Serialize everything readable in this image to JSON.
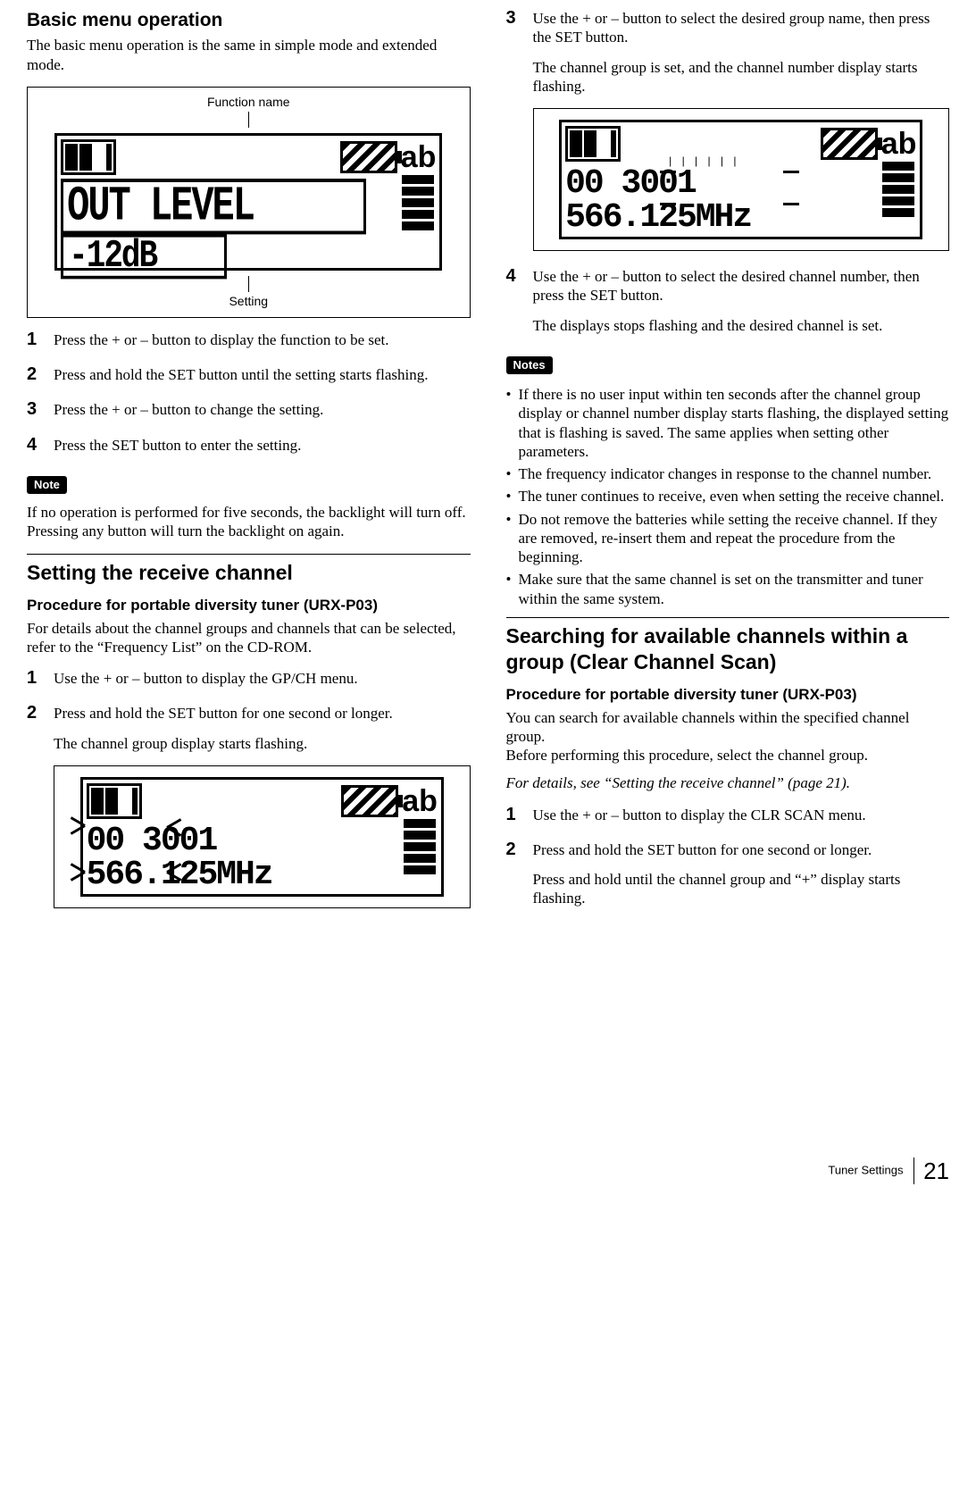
{
  "left": {
    "h_basic": "Basic menu operation",
    "basic_intro": "The basic menu operation is the same in simple mode and extended mode.",
    "fig1": {
      "label_top": "Function name",
      "lcd_ab": "ab",
      "lcd_line1": "OUT LEVEL",
      "lcd_line2": "-12dB",
      "label_bottom": "Setting"
    },
    "steps1": [
      "Press the + or – button to display the function to be set.",
      "Press and hold the SET button until the setting starts flashing.",
      "Press the + or – button to change the setting.",
      "Press the SET button to enter the setting."
    ],
    "note_badge": "Note",
    "note_text": "If no operation is performed for five seconds, the backlight will turn off. Pressing any button will turn the backlight on again.",
    "h_receive": "Setting the receive channel",
    "sub_proc": "Procedure for portable diversity tuner (URX-P03)",
    "proc_intro": "For details about the channel groups and channels that can be selected, refer to the “Frequency List” on the CD-ROM.",
    "steps2": {
      "s1": "Use the + or – button to display the GP/CH menu.",
      "s2": "Press and hold the SET button for one second or longer.",
      "s2_result": "The channel group display starts flashing."
    },
    "fig2": {
      "lcd_ab": "ab",
      "lcd_line1": "00  3001",
      "lcd_line2": "566.125MHz"
    }
  },
  "right": {
    "steps3": {
      "s3": "Use the + or – button to select the desired group name, then press the SET button.",
      "s3_result": "The channel group is set, and the channel number display starts flashing.",
      "s4": "Use the + or – button to select the desired channel number, then press the SET button.",
      "s4_result": "The displays stops flashing and the desired channel is set."
    },
    "fig3": {
      "lcd_ab": "ab",
      "lcd_line1": "00  3001",
      "lcd_line2": "566.125MHz"
    },
    "notes_badge": "Notes",
    "notes": [
      "If there is no user input within ten seconds after the channel group display or channel number display starts flashing, the displayed setting that is flashing is saved. The same applies when setting other parameters.",
      "The frequency indicator changes in response to the channel number.",
      "The tuner continues to receive, even when setting the receive channel.",
      "Do not remove the batteries while setting the receive channel. If they are removed, re-insert them and repeat the procedure from the beginning.",
      "Make sure that the same channel is set on the transmitter and tuner within the same system."
    ],
    "h_search": "Searching for available channels within a group (Clear Channel Scan)",
    "sub_proc2": "Procedure for portable diversity tuner (URX-P03)",
    "search_intro1": "You can search for available channels within the specified channel group.",
    "search_intro2": "Before performing this procedure, select the channel group.",
    "xref": "For details, see “Setting the receive channel” (page 21).",
    "steps4": {
      "s1": "Use the + or – button to display the CLR SCAN menu.",
      "s2": "Press and hold the SET button for one second or longer.",
      "s2_result": "Press and hold until the channel group and “+” display starts flashing."
    }
  },
  "footer": {
    "section": "Tuner Settings",
    "page": "21"
  }
}
